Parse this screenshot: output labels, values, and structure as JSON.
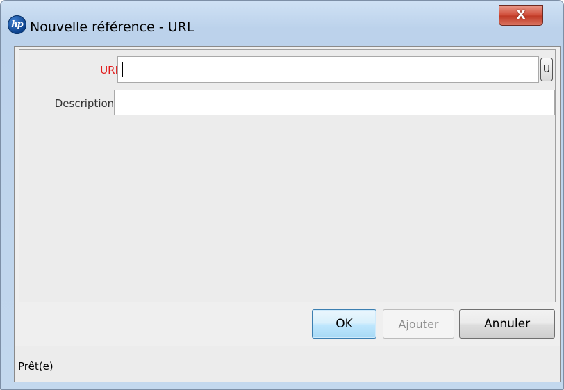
{
  "window": {
    "title": "Nouvelle référence - URL",
    "logo_text": "hp",
    "close_glyph": "X"
  },
  "form": {
    "url": {
      "label": "URL:",
      "value": "",
      "required": true,
      "required_color": "#e21b1b",
      "button_label": "U"
    },
    "description": {
      "label": "Description :",
      "value": ""
    }
  },
  "buttons": {
    "ok": "OK",
    "add": "Ajouter",
    "add_enabled": false,
    "cancel": "Annuler"
  },
  "status": {
    "text": "Prêt(e)"
  }
}
